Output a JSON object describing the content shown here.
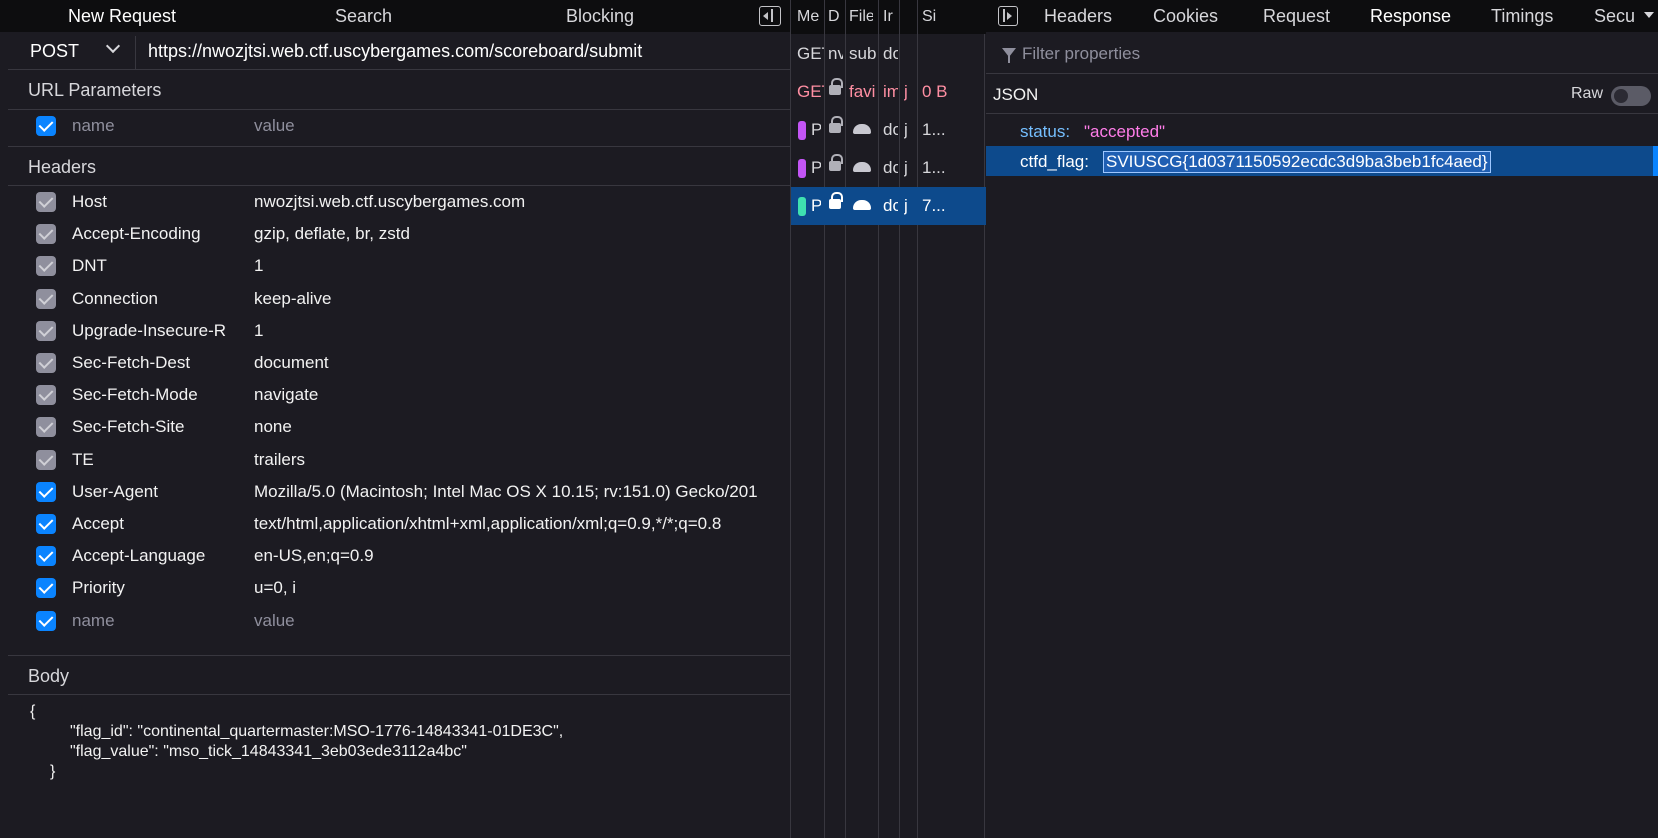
{
  "left": {
    "tabs": [
      "New Request",
      "Search",
      "Blocking"
    ],
    "method": "POST",
    "url": "https://nwozjtsi.web.ctf.uscybergames.com/scoreboard/submit",
    "url_params_title": "URL Parameters",
    "url_params": [
      {
        "checked": true,
        "name": "name",
        "value": "value",
        "placeholder": true
      }
    ],
    "headers_title": "Headers",
    "headers": [
      {
        "checked": "dim",
        "name": "Host",
        "value": "nwozjtsi.web.ctf.uscybergames.com"
      },
      {
        "checked": "dim",
        "name": "Accept-Encoding",
        "value": "gzip, deflate, br, zstd"
      },
      {
        "checked": "dim",
        "name": "DNT",
        "value": "1"
      },
      {
        "checked": "dim",
        "name": "Connection",
        "value": "keep-alive"
      },
      {
        "checked": "dim",
        "name": "Upgrade-Insecure-R",
        "value": "1"
      },
      {
        "checked": "dim",
        "name": "Sec-Fetch-Dest",
        "value": "document"
      },
      {
        "checked": "dim",
        "name": "Sec-Fetch-Mode",
        "value": "navigate"
      },
      {
        "checked": "dim",
        "name": "Sec-Fetch-Site",
        "value": "none"
      },
      {
        "checked": "dim",
        "name": "TE",
        "value": "trailers"
      },
      {
        "checked": "on",
        "name": "User-Agent",
        "value": "Mozilla/5.0 (Macintosh; Intel Mac OS X 10.15; rv:151.0) Gecko/201"
      },
      {
        "checked": "on",
        "name": "Accept",
        "value": "text/html,application/xhtml+xml,application/xml;q=0.9,*/*;q=0.8"
      },
      {
        "checked": "on",
        "name": "Accept-Language",
        "value": "en-US,en;q=0.9"
      },
      {
        "checked": "on",
        "name": "Priority",
        "value": "u=0, i"
      },
      {
        "checked": "on",
        "name": "name",
        "value": "value",
        "placeholder": true
      }
    ],
    "body_title": "Body",
    "body_lines": [
      "{",
      "\"flag_id\": \"continental_quartermaster:MSO-1776-14843341-01DE3C\",",
      "\"flag_value\": \"mso_tick_14843341_3eb03ede3112a4bc\"",
      "}"
    ]
  },
  "middle": {
    "columns": [
      "Me",
      "D",
      "File",
      "Ir",
      "Si"
    ],
    "rows": [
      {
        "method": "GET",
        "domain": "nv",
        "file": "sub",
        "initiator": "do",
        "type": "",
        "size": "",
        "style": "normal",
        "badge": "",
        "lock": false,
        "turtle": false
      },
      {
        "method": "GET",
        "domain": "",
        "file": "favi",
        "initiator": "im",
        "type": "j",
        "size": "0 B",
        "style": "red",
        "badge": "",
        "lock": true,
        "turtle": false
      },
      {
        "method": "POS",
        "domain": "",
        "file": "",
        "initiator": "do",
        "type": "j",
        "size": "1...",
        "style": "normal",
        "badge": "#c355f5",
        "lock": true,
        "turtle": true
      },
      {
        "method": "POS",
        "domain": "",
        "file": "",
        "initiator": "do",
        "type": "j",
        "size": "1...",
        "style": "normal",
        "badge": "#c355f5",
        "lock": true,
        "turtle": true
      },
      {
        "method": "POS",
        "domain": "",
        "file": "",
        "initiator": "do",
        "type": "j",
        "size": "7...",
        "style": "selected",
        "badge": "#3fe1b0",
        "lock": true,
        "turtle": true
      }
    ]
  },
  "right": {
    "tabs": [
      "Headers",
      "Cookies",
      "Request",
      "Response",
      "Timings",
      "Secu"
    ],
    "active_tab": "Response",
    "filter_placeholder": "Filter properties",
    "json_label": "JSON",
    "raw_label": "Raw",
    "raw_enabled": false,
    "json": [
      {
        "key": "status:",
        "value": "\"accepted\"",
        "highlight": false
      },
      {
        "key": "ctfd_flag:",
        "value": "SVIUSCG{1d0371150592ecdc3d9ba3beb1fc4aed}",
        "highlight": true
      }
    ]
  },
  "colors": {
    "accent": "#0a84ff",
    "selected_row": "#0d4a8c",
    "json_key": "#75bfff",
    "json_string": "#ff7de9",
    "error_row": "#ff8fa3"
  }
}
